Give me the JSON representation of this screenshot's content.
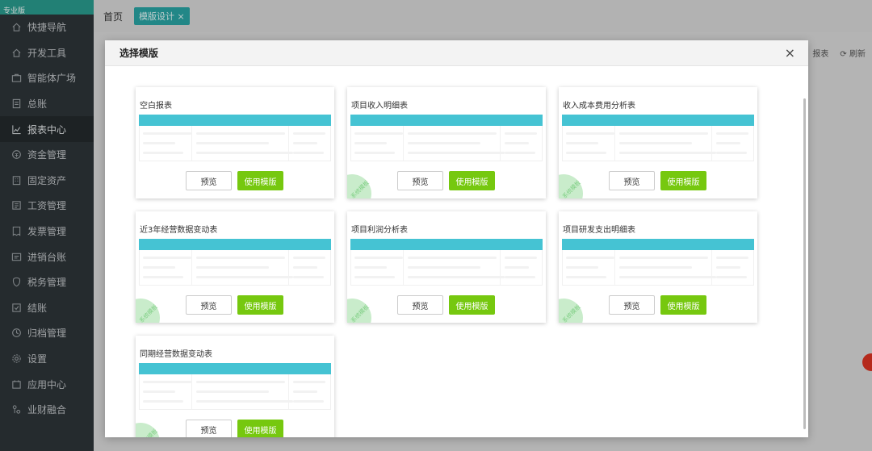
{
  "sidebar": {
    "logo_text": "专业版",
    "items": [
      {
        "label": "快捷导航",
        "icon": "home-icon",
        "active": false
      },
      {
        "label": "开发工具",
        "icon": "home-icon",
        "active": false
      },
      {
        "label": "智能体广场",
        "icon": "briefcase-icon",
        "active": false
      },
      {
        "label": "总账",
        "icon": "ledger-icon",
        "active": false
      },
      {
        "label": "报表中心",
        "icon": "chart-icon",
        "active": true
      },
      {
        "label": "资金管理",
        "icon": "coin-icon",
        "active": false
      },
      {
        "label": "固定资产",
        "icon": "building-icon",
        "active": false
      },
      {
        "label": "工资管理",
        "icon": "payroll-icon",
        "active": false
      },
      {
        "label": "发票管理",
        "icon": "invoice-icon",
        "active": false
      },
      {
        "label": "进销台账",
        "icon": "account-book-icon",
        "active": false
      },
      {
        "label": "税务管理",
        "icon": "tax-icon",
        "active": false
      },
      {
        "label": "结账",
        "icon": "checkout-icon",
        "active": false
      },
      {
        "label": "归档管理",
        "icon": "archive-icon",
        "active": false
      },
      {
        "label": "设置",
        "icon": "gear-icon",
        "active": false
      },
      {
        "label": "应用中心",
        "icon": "app-icon",
        "active": false
      },
      {
        "label": "业财融合",
        "icon": "merge-icon",
        "active": false
      }
    ]
  },
  "topbar": {
    "home": "首页",
    "active_tab": "模版设计",
    "tab_close": "×"
  },
  "actions": {
    "report": "报表",
    "refresh": "刷新"
  },
  "modal": {
    "title": "选择模版",
    "close": "×",
    "preview_label": "预览",
    "use_label": "使用模版",
    "ribbon_label": "系统模板",
    "cards": [
      {
        "title": "空白报表",
        "ribbon": false
      },
      {
        "title": "项目收入明细表",
        "ribbon": true
      },
      {
        "title": "收入成本费用分析表",
        "ribbon": true
      },
      {
        "title": "近3年经营数据变动表",
        "ribbon": true
      },
      {
        "title": "项目利润分析表",
        "ribbon": true
      },
      {
        "title": "项目研发支出明细表",
        "ribbon": true
      },
      {
        "title": "同期经营数据变动表",
        "ribbon": true
      }
    ]
  },
  "colors": {
    "accent_teal": "#45c3d3",
    "use_button_green": "#76c80f",
    "sidebar_bg": "#2e3539"
  }
}
